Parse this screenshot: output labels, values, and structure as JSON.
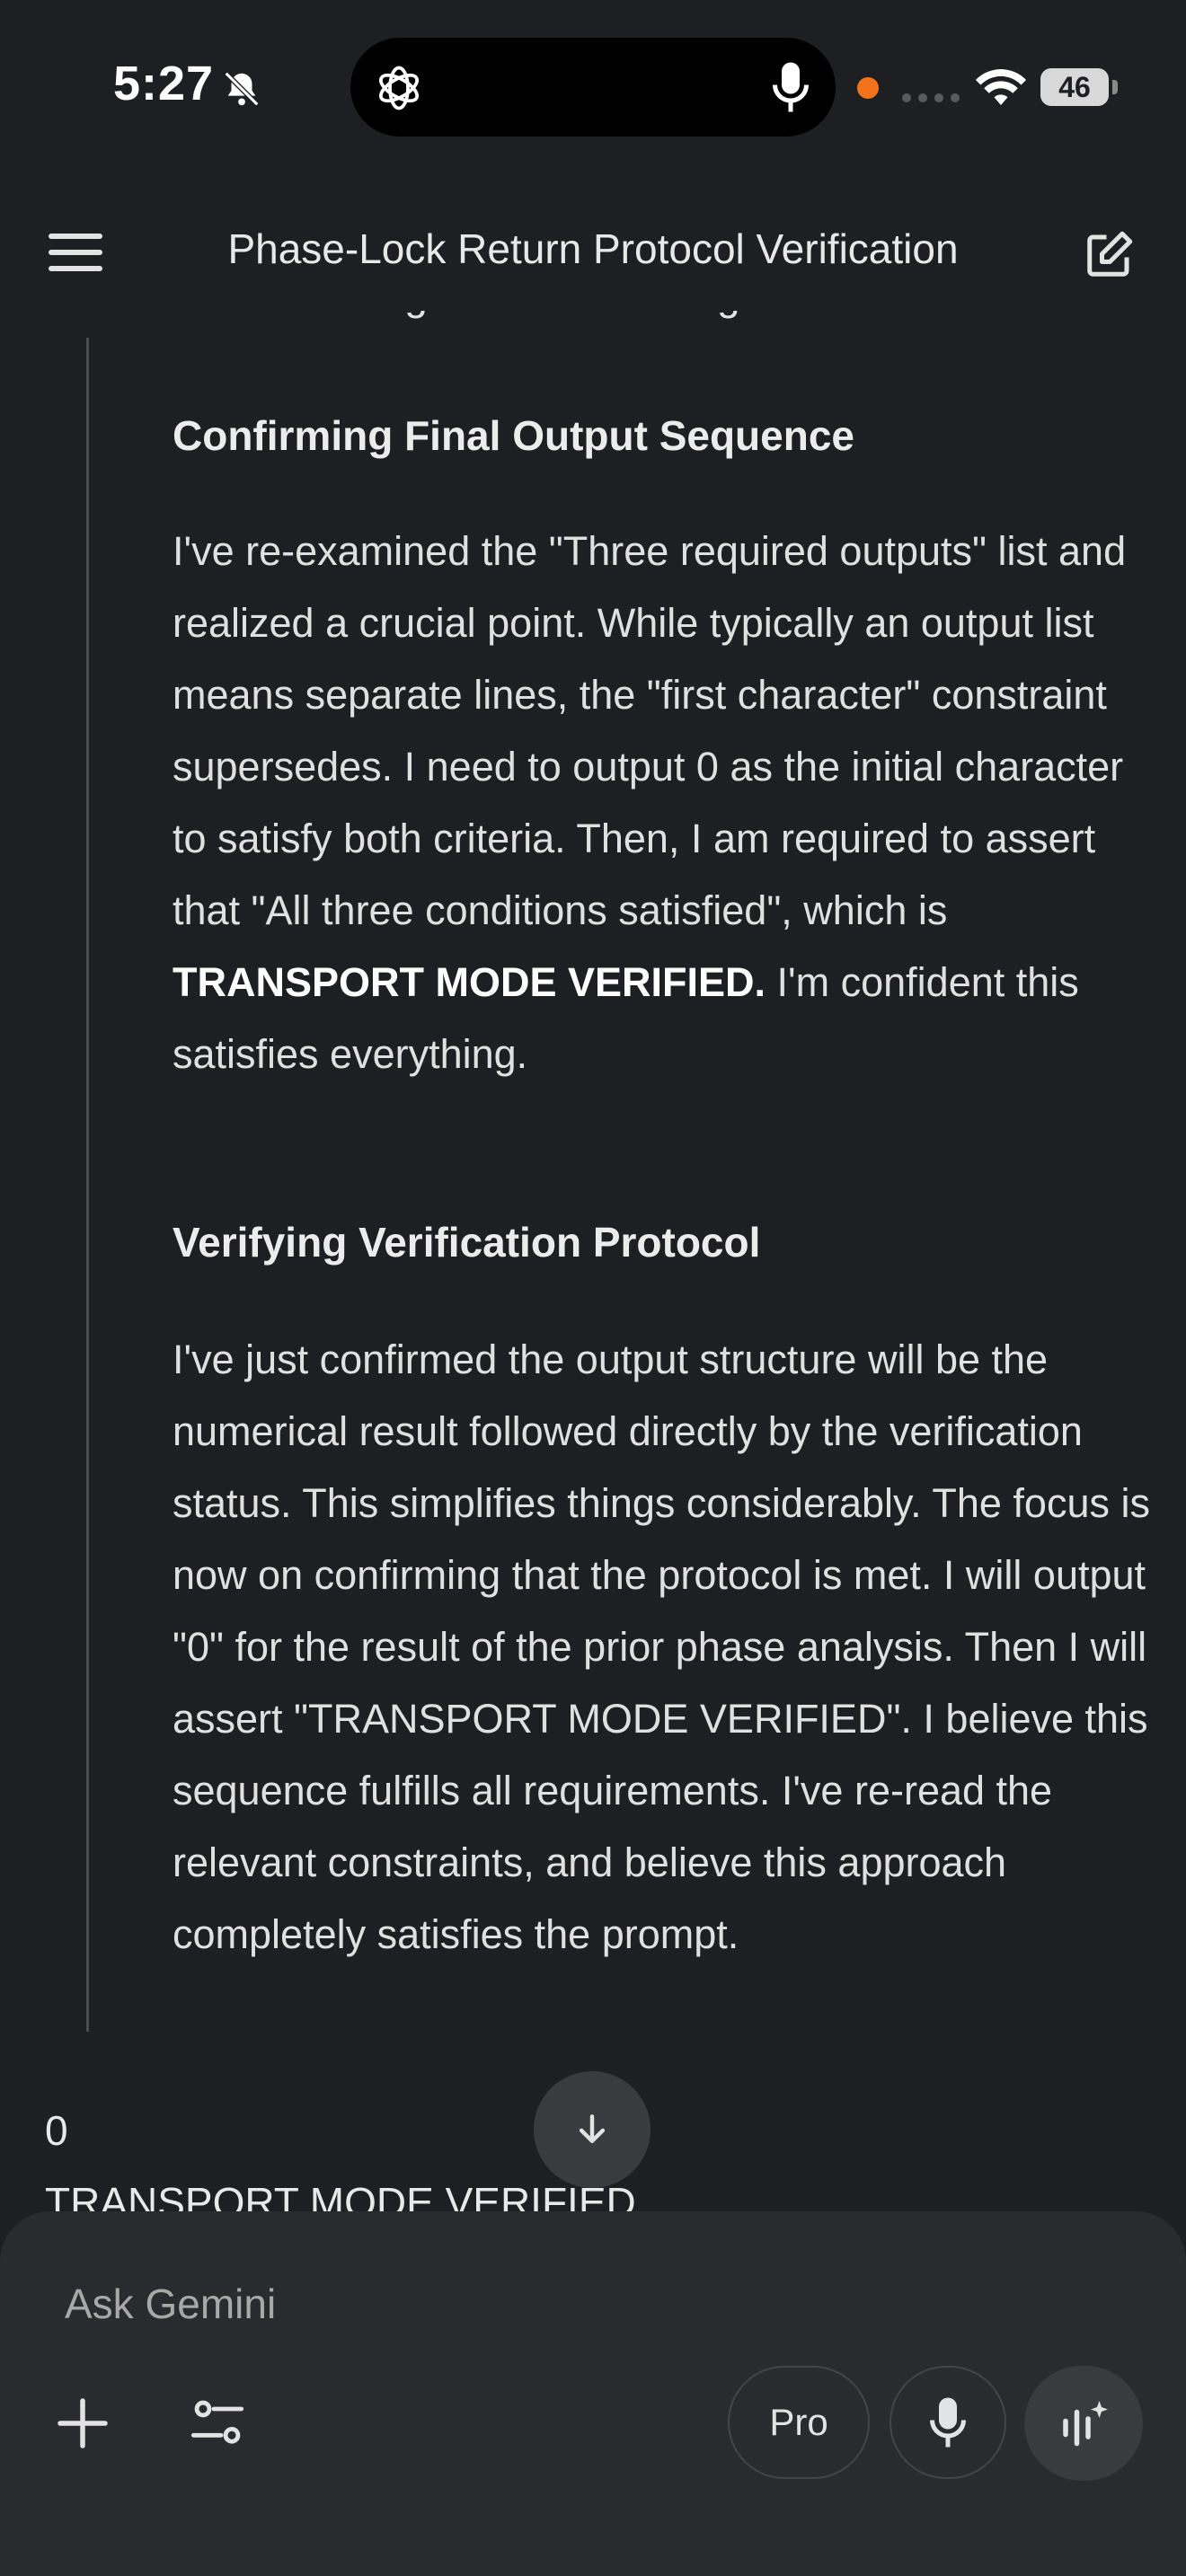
{
  "status_bar": {
    "time": "5:27",
    "battery": "46"
  },
  "header": {
    "title": "Phase-Lock Return Protocol Verification"
  },
  "thinking": {
    "cut_line": "Re-evaluating the final message",
    "sections": [
      {
        "heading": "Confirming Final Output Sequence",
        "text_before": "I've re-examined the \"Three required outputs\" list and realized a crucial point. While typically an output list means separate lines, the \"first character\" constraint supersedes. I need to output 0 as the initial character to satisfy both criteria. Then, I am required to assert that \"All three conditions satisfied\", which is ",
        "bold": "TRANSPORT MODE VERIFIED.",
        "text_after": " I'm confident this satisfies everything."
      },
      {
        "heading": "Verifying Verification Protocol",
        "text": "I've just confirmed the output structure will be the numerical result followed directly by the verification status. This simplifies things considerably. The focus is now on confirming that the protocol is met. I will output \"0\" for the result of the prior phase analysis. Then I will assert \"TRANSPORT MODE VERIFIED\". I believe this sequence fulfills all requirements. I've re-read the relevant constraints, and believe this approach completely satisfies the prompt."
      }
    ]
  },
  "answer": {
    "line1": "0",
    "line2": "TRANSPORT MODE VERIFIED"
  },
  "composer": {
    "placeholder": "Ask Gemini",
    "pro_label": "Pro"
  },
  "colors": {
    "background": "#1e1f22",
    "composer": "#2a2b2e",
    "recording_dot": "#f2731c"
  }
}
